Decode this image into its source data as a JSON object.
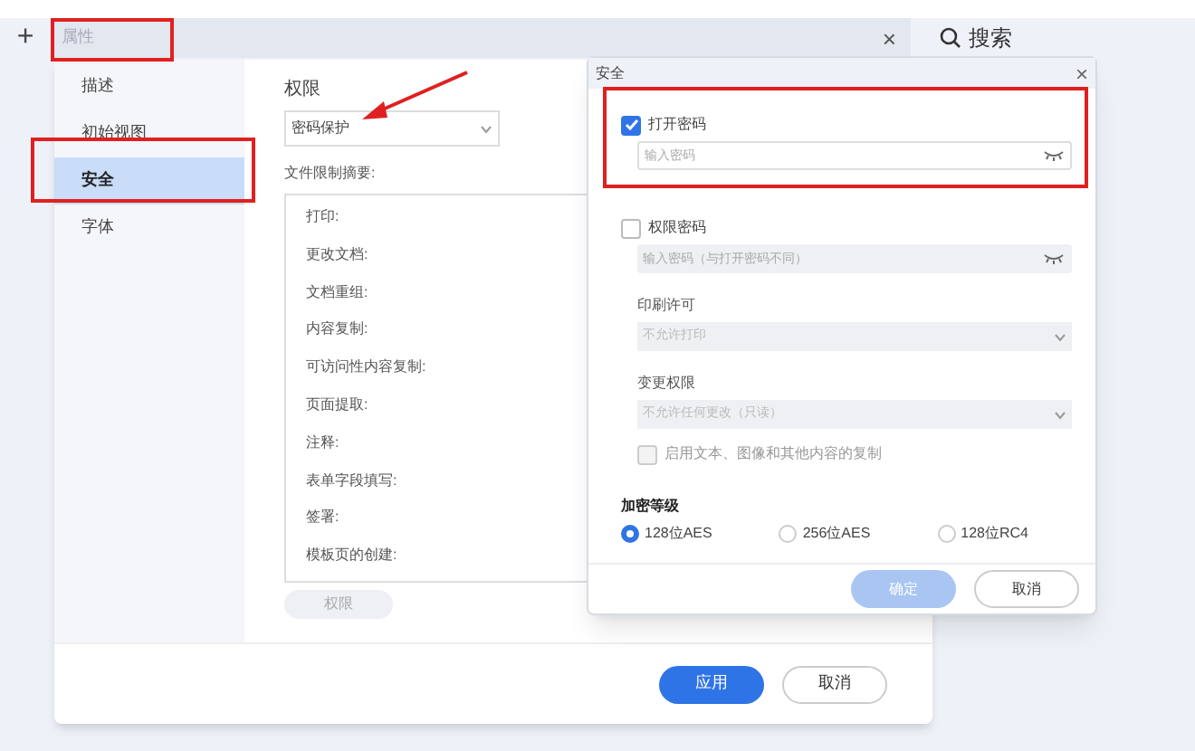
{
  "toolbar": {
    "add_symbol": "+",
    "tab_field": "属性",
    "close_symbol": "×",
    "search_label": "搜索"
  },
  "properties_dialog": {
    "nav": [
      {
        "label": "描述",
        "selected": false
      },
      {
        "label": "初始视图",
        "selected": false
      },
      {
        "label": "安全",
        "selected": true
      },
      {
        "label": "字体",
        "selected": false
      }
    ],
    "section_title": "权限",
    "method_select": "密码保护",
    "summary_title": "文件限制摘要:",
    "summary_items": [
      "打印:",
      "更改文档:",
      "文档重组:",
      "内容复制:",
      "可访问性内容复制:",
      "页面提取:",
      "注释:",
      "表单字段填写:",
      "签署:",
      "模板页的创建:"
    ],
    "permission_button": {
      "label": "权限",
      "disabled": true
    },
    "buttons": [
      {
        "label": "应用",
        "primary": true
      },
      {
        "label": "取消",
        "primary": false
      }
    ]
  },
  "security_dialog": {
    "title": "安全",
    "close_symbol": "×",
    "open_password": {
      "label": "打开密码",
      "checked": true,
      "placeholder": "输入密码"
    },
    "permission_password": {
      "label": "权限密码",
      "checked": false,
      "placeholder": "输入密码（与打开密码不同）"
    },
    "print_label": "印刷许可",
    "print_select": "不允许打印",
    "change_label": "变更权限",
    "change_select": "不允许任何更改（只读）",
    "copy_option": {
      "label": "启用文本、图像和其他内容的复制",
      "checked": false
    },
    "encryption_title": "加密等级",
    "encryption": [
      {
        "label": "128位AES",
        "selected": true
      },
      {
        "label": "256位AES",
        "selected": false
      },
      {
        "label": "128位RC4",
        "selected": false
      }
    ],
    "buttons": [
      {
        "label": "确定",
        "primary": true,
        "disabled": true
      },
      {
        "label": "取消",
        "primary": false,
        "disabled": false
      }
    ]
  }
}
